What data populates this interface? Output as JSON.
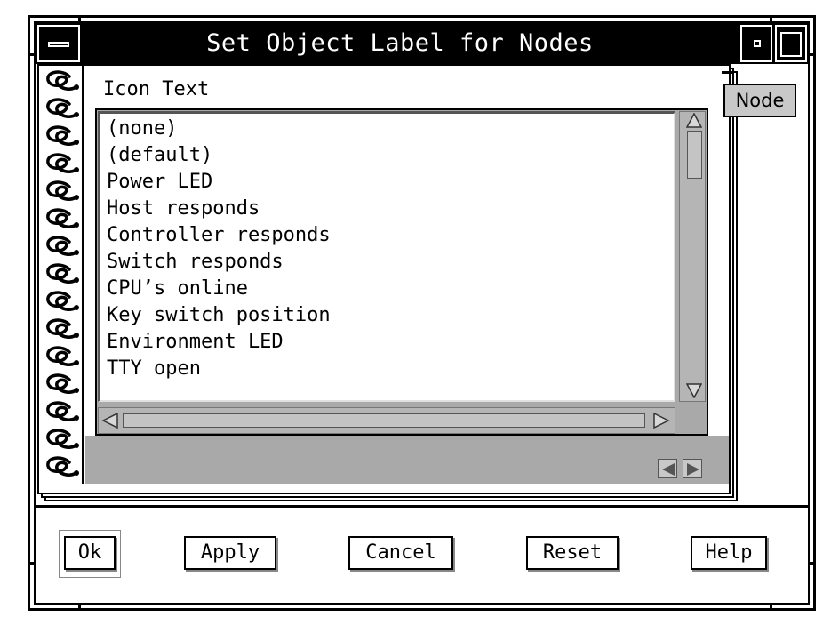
{
  "window": {
    "title": "Set Object Label for Nodes"
  },
  "notebook": {
    "page_label": "Icon Text",
    "tab_label": "Node",
    "list_items": [
      "(none)",
      "(default)",
      "Power LED",
      "Host responds",
      "Controller responds",
      "Switch responds",
      "CPU’s online",
      "Key switch position",
      "Environment LED",
      "TTY open"
    ]
  },
  "buttons": {
    "ok": "Ok",
    "apply": "Apply",
    "cancel": "Cancel",
    "reset": "Reset",
    "help": "Help"
  },
  "icons": {
    "window_menu": "window-menu-icon",
    "minimize": "minimize-icon",
    "maximize": "maximize-icon",
    "scroll_up": "triangle-up-icon",
    "scroll_down": "triangle-down-icon",
    "scroll_left": "triangle-left-icon",
    "scroll_right": "triangle-right-icon",
    "page_prev": "page-back-icon",
    "page_next": "page-forward-icon",
    "spiral": "spiral-binding-icon"
  },
  "colors": {
    "titlebar": "#000000",
    "panel_gray": "#a9a9a9",
    "background": "#ffffff"
  }
}
